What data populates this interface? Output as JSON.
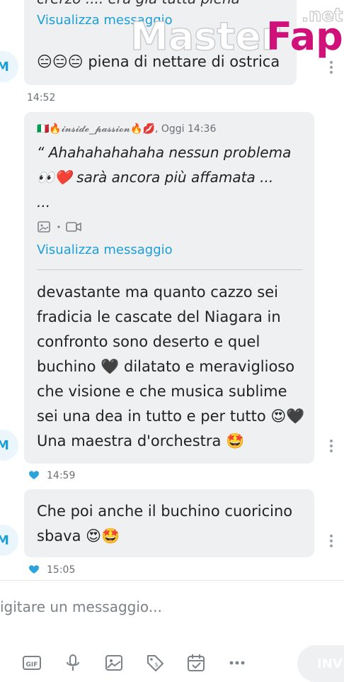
{
  "watermark": "MasterFap",
  "watermark_suffix": ".net",
  "msg1": {
    "partial_top": "crerzo .... era già tutta piena",
    "view_link": "Visualizza messaggio",
    "text": "😑😑😑 piena di nettare di ostrica",
    "avatar": "M",
    "time": "14:52"
  },
  "msg2": {
    "reply_author": "🇮🇹🔥𝓲𝓷𝓼𝓲𝓭𝓮_𝓹𝓪𝓼𝓼𝓲𝓸𝓷🔥💋",
    "reply_time": ", Oggi 14:36",
    "quote": "“ Ahahahahahaha nessun problema\n👀❤️ sarà ancora più affamata ...\n...",
    "view_link": "Visualizza messaggio",
    "text": "devastante ma quanto cazzo sei\nfradicia le cascate del Niagara in\nconfronto sono deserto e quel\nbuchino 🖤 dilatato e meraviglioso\nche visione e che musica sublime\nsei una dea in tutto e per tutto 😍🖤\nUna maestra d'orchestra 🤩",
    "avatar": "M",
    "time": "14:59"
  },
  "msg3": {
    "text": "Che poi anche il buchino cuoricino\nsbava 😍🤩",
    "avatar": "M",
    "time": "15:05"
  },
  "composer": {
    "placeholder": "igitare un messaggio...",
    "send_label": "INV"
  },
  "toolbar": {
    "gif_label": "GIF",
    "icons": [
      "gif-icon",
      "microphone-icon",
      "image-icon",
      "tag-icon",
      "calendar-check-icon",
      "more-icon"
    ]
  },
  "colors": {
    "accent": "#1b9fd6",
    "bubble": "#eef0f2",
    "heart": "#2aa3dc"
  }
}
